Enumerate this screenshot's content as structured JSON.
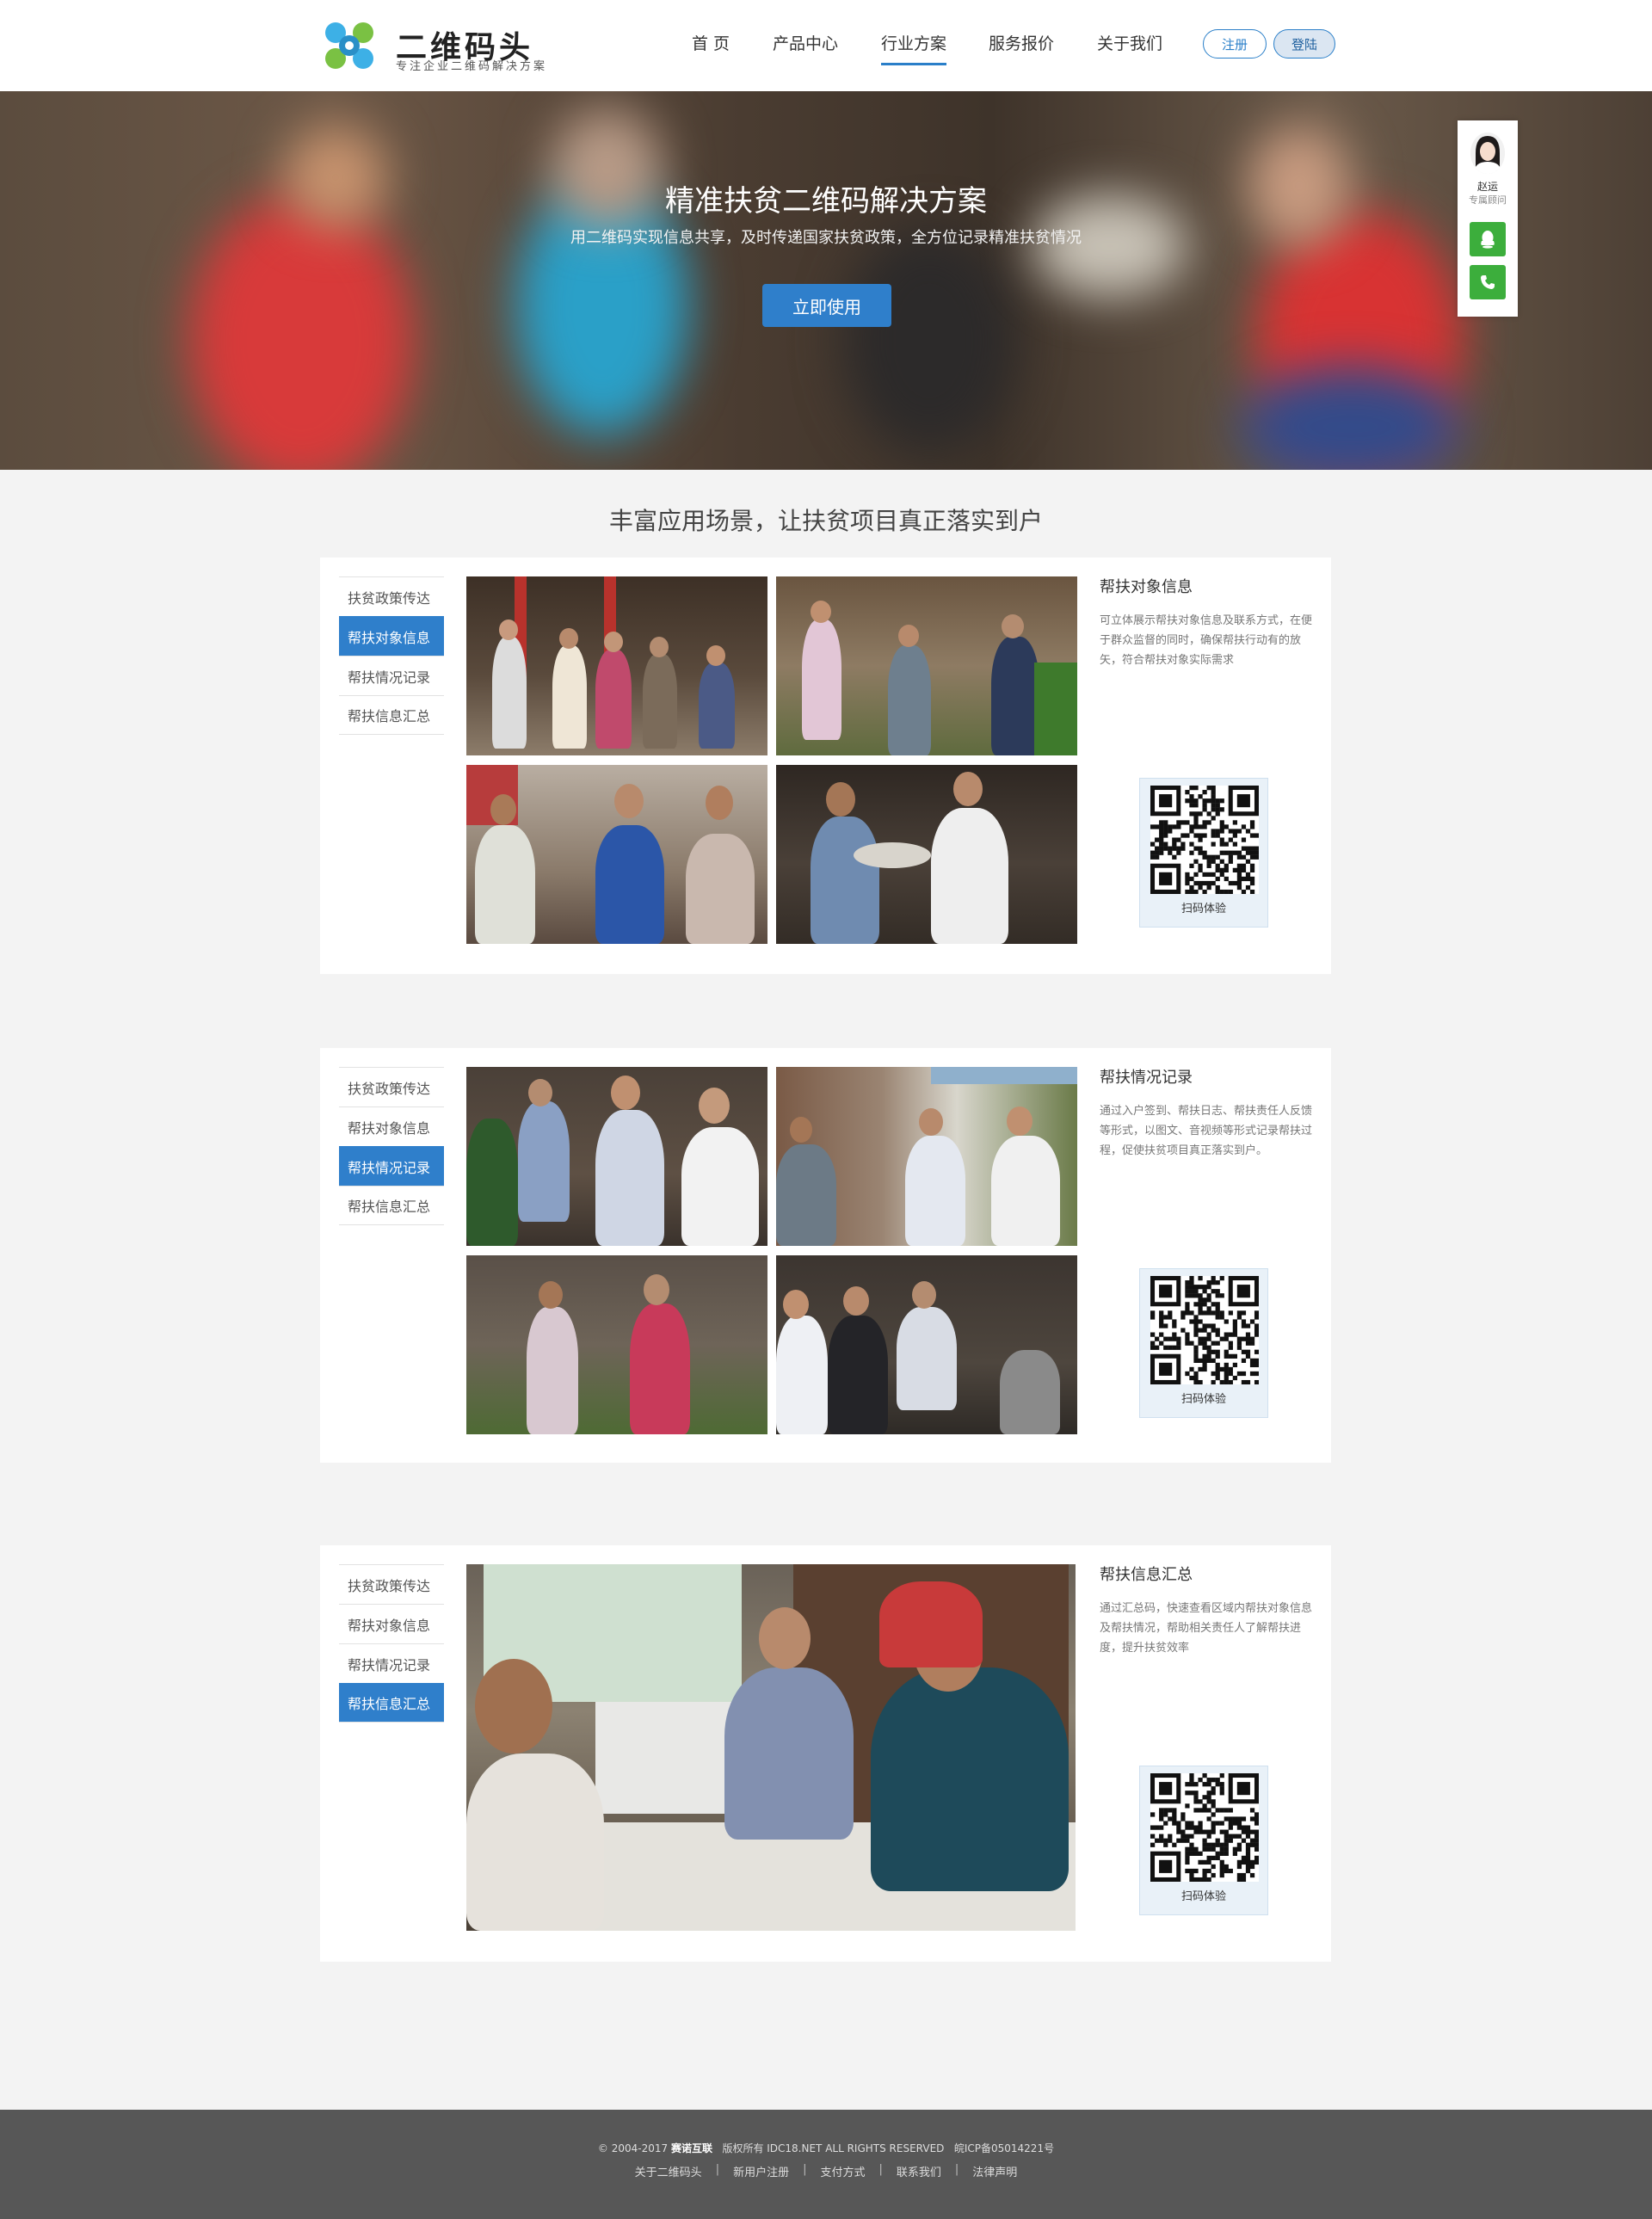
{
  "brand": {
    "title": "二维码头",
    "subtitle": "专注企业二维码解决方案"
  },
  "nav": {
    "items": [
      {
        "label": "首 页"
      },
      {
        "label": "产品中心"
      },
      {
        "label": "行业方案",
        "active": true
      },
      {
        "label": "服务报价"
      },
      {
        "label": "关于我们"
      }
    ],
    "register": "注册",
    "login": "登陆"
  },
  "hero": {
    "title": "精准扶贫二维码解决方案",
    "subtitle": "用二维码实现信息共享，及时传递国家扶贫政策，全方位记录精准扶贫情况",
    "cta": "立即使用"
  },
  "consultant": {
    "name": "赵运",
    "role": "专属顾问",
    "qq_icon": "qq-icon",
    "phone_icon": "phone-icon"
  },
  "section": {
    "title": "丰富应用场景，让扶贫项目真正落实到户"
  },
  "tabs": [
    "扶贫政策传达",
    "帮扶对象信息",
    "帮扶情况记录",
    "帮扶信息汇总"
  ],
  "cards": [
    {
      "active_tab": 1,
      "title": "帮扶对象信息",
      "text": "可立体展示帮扶对象信息及联系方式，在便于群众监督的同时，确保帮扶行动有的放矢，符合帮扶对象实际需求",
      "qr_label": "扫码体验"
    },
    {
      "active_tab": 2,
      "title": "帮扶情况记录",
      "text": "通过入户签到、帮扶日志、帮扶责任人反馈等形式，以图文、音视频等形式记录帮扶过程，促使扶贫项目真正落实到户。",
      "qr_label": "扫码体验"
    },
    {
      "active_tab": 3,
      "title": "帮扶信息汇总",
      "text": "通过汇总码，快速查看区域内帮扶对象信息及帮扶情况，帮助相关责任人了解帮扶进度，提升扶贫效率",
      "qr_label": "扫码体验"
    }
  ],
  "footer": {
    "copyright_prefix": "© 2004-2017",
    "company": "赛诺互联",
    "rights": "版权所有 IDC18.NET ALL RIGHTS RESERVED",
    "icp": "皖ICP备05014221号",
    "links": [
      "关于二维码头",
      "新用户注册",
      "支付方式",
      "联系我们",
      "法律声明"
    ]
  },
  "colors": {
    "accent": "#2f7fcb",
    "consult_green": "#3cae3c",
    "footer_bg": "#575757"
  }
}
